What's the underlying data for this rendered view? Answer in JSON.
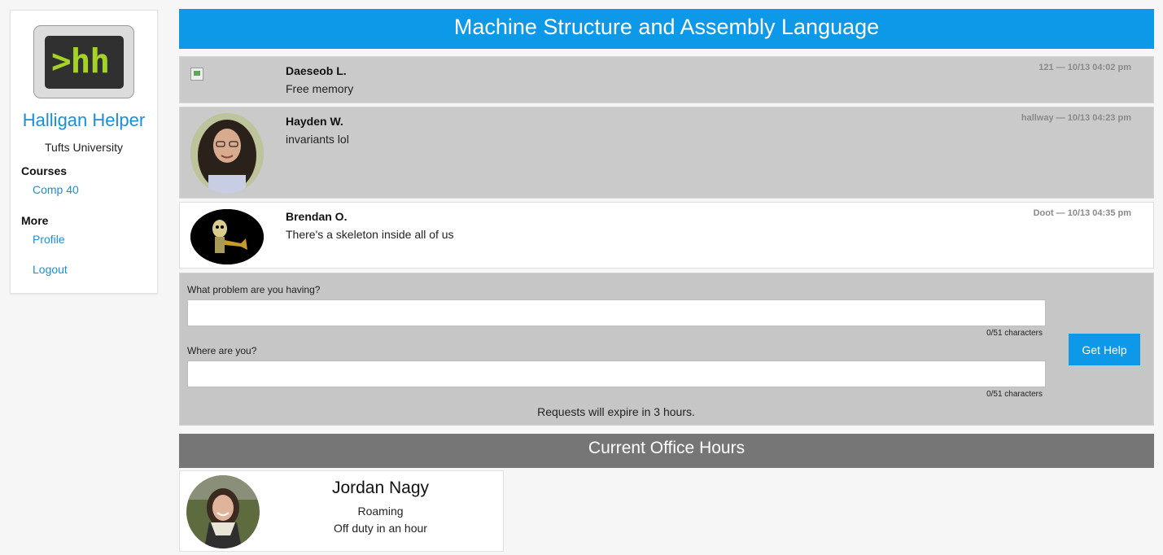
{
  "sidebar": {
    "logo_text": ">hh",
    "app_name": "Halligan Helper",
    "university": "Tufts University",
    "courses_heading": "Courses",
    "courses": [
      {
        "label": "Comp 40"
      }
    ],
    "more_heading": "More",
    "more_links": [
      {
        "label": "Profile"
      },
      {
        "label": "Logout"
      }
    ]
  },
  "course_title": "Machine Structure and Assembly Language",
  "requests": [
    {
      "name": "Daeseob L.",
      "message": "Free memory",
      "meta": "121 — 10/13 04:02 pm",
      "avatar": "broken-image-icon",
      "highlighted": true
    },
    {
      "name": "Hayden W.",
      "message": "invariants lol",
      "meta": "hallway — 10/13 04:23 pm",
      "avatar": "curly-hair-person-photo",
      "highlighted": true
    },
    {
      "name": "Brendan O.",
      "message": "There's a skeleton inside all of us",
      "meta": "Doot — 10/13 04:35 pm",
      "avatar": "skeleton-trumpet-photo",
      "highlighted": false
    }
  ],
  "form": {
    "problem_label": "What problem are you having?",
    "problem_value": "",
    "problem_count": "0/51 characters",
    "location_label": "Where are you?",
    "location_value": "",
    "location_count": "0/51 characters",
    "submit_label": "Get Help",
    "expire_note": "Requests will expire in 3 hours."
  },
  "office_hours": {
    "heading": "Current Office Hours",
    "tas": [
      {
        "name": "Jordan Nagy",
        "location": "Roaming",
        "status": "Off duty in an hour",
        "avatar": "person-scarf-photo"
      }
    ]
  },
  "colors": {
    "accent": "#0d98e8",
    "request_bg": "#cacaca",
    "form_bg": "#c6c6c6",
    "oh_header_bg": "#767676",
    "logo_green": "#a4d229"
  }
}
